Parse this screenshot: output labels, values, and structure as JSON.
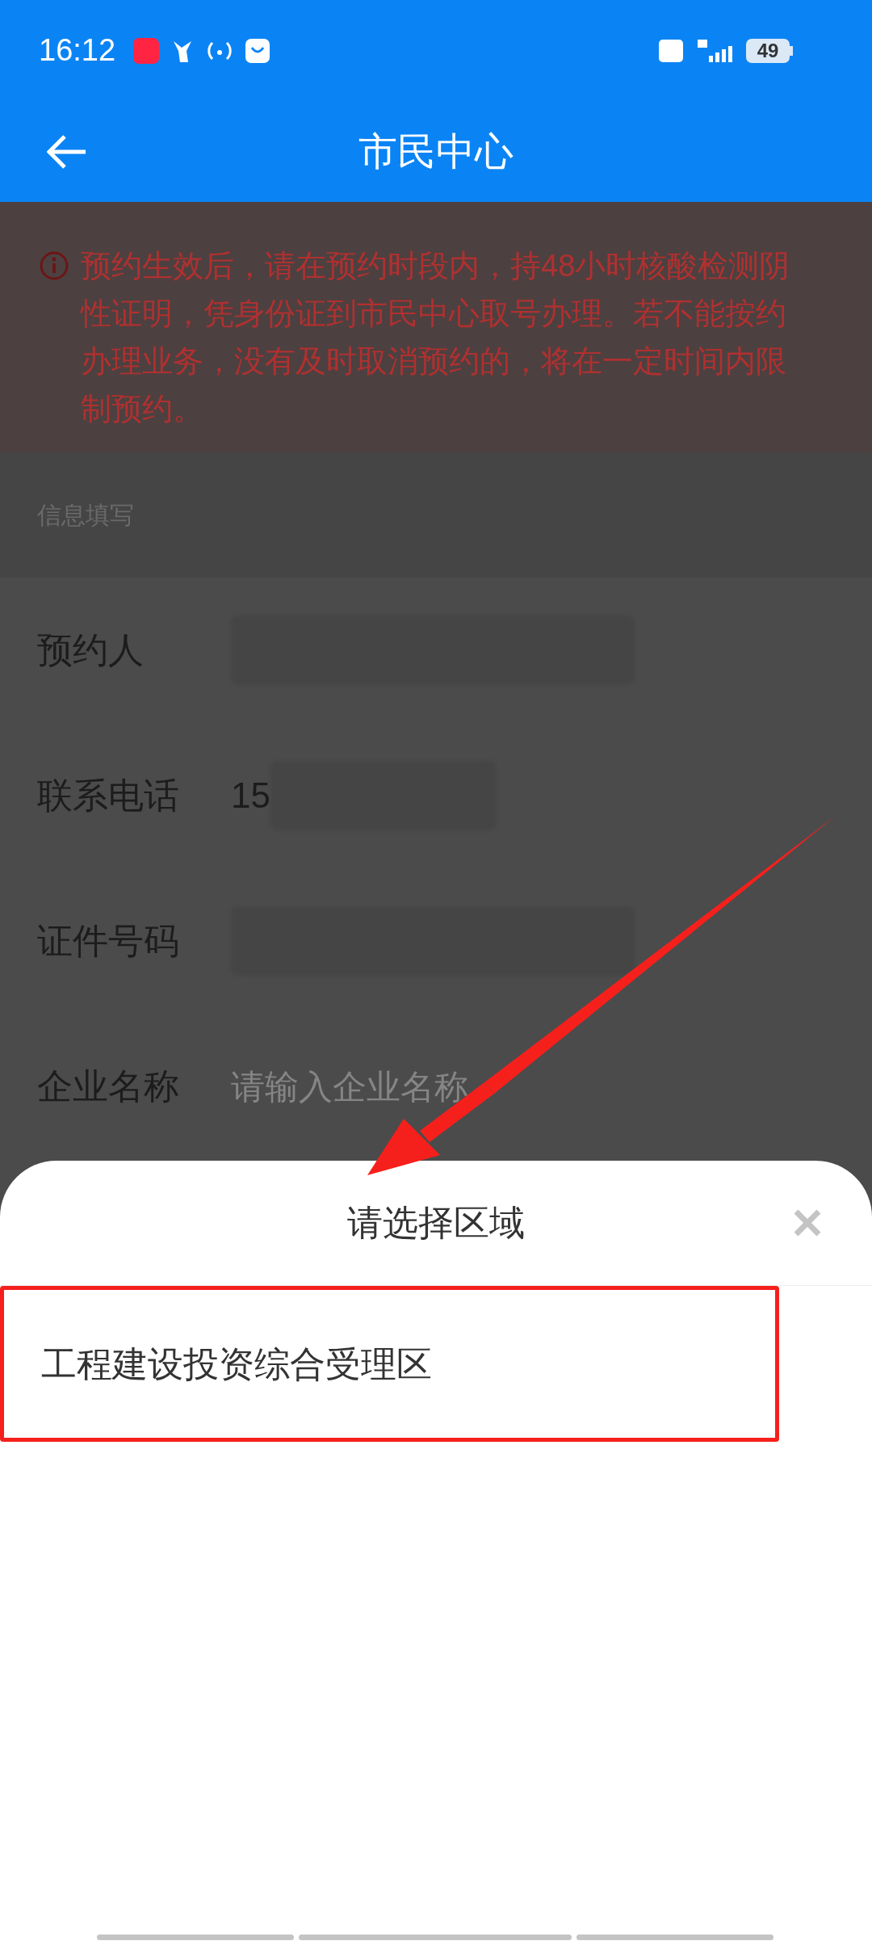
{
  "status_bar": {
    "time": "16:12",
    "battery": "49"
  },
  "header": {
    "title": "市民中心"
  },
  "notice": {
    "text": "预约生效后，请在预约时段内，持48小时核酸检测阴性证明，凭身份证到市民中心取号办理。若不能按约办理业务，没有及时取消预约的，将在一定时间内限制预约。"
  },
  "form": {
    "section": "信息填写",
    "rows": [
      {
        "label": "预约人",
        "kind": "redacted",
        "value": ""
      },
      {
        "label": "联系电话",
        "kind": "partial",
        "value": "15"
      },
      {
        "label": "证件号码",
        "kind": "redacted",
        "value": ""
      },
      {
        "label": "企业名称",
        "kind": "input",
        "placeholder": "请输入企业名称"
      }
    ]
  },
  "sheet": {
    "title": "请选择区域",
    "options": [
      {
        "label": "工程建设投资综合受理区",
        "selected": true
      }
    ]
  }
}
